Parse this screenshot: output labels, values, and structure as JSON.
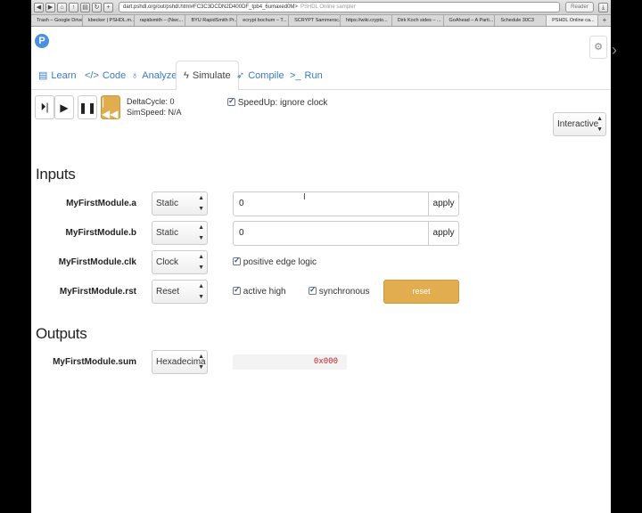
{
  "browser": {
    "url": "dart.pshdl.org/out/pshdl.html#FC3C3DCDN2D400DF_tpb4_6umaxed0M>",
    "page_title": "PSHDL Online sampler",
    "reader_label": "Reader",
    "bookmarks": [
      "Trash – Google Drive",
      "kbecker | PSHDL.m...",
      "rapidsmith – (Nwc...",
      "BYU RapidSmith Pr...",
      "ecrypt bochum – T...",
      "SCRYPT Sammersc...",
      "https://wiki.crypto...",
      "Dirk Koch sides – ...",
      "GoAhead – A Parti...",
      "Schedule 30C3",
      "PSHDL Online ca..."
    ]
  },
  "app": {
    "logo": "P",
    "corner_icon": "puzzle-icon",
    "tabs": [
      {
        "label": "Learn",
        "icon": "book-icon"
      },
      {
        "label": "Code",
        "icon": "code-icon"
      },
      {
        "label": "Analyze",
        "icon": "stethoscope-icon"
      },
      {
        "label": "Simulate",
        "icon": "bolt-icon"
      },
      {
        "label": "Compile",
        "icon": "rocket-icon"
      },
      {
        "label": "Run",
        "icon": "terminal-icon"
      }
    ],
    "active_tab": "Simulate"
  },
  "sim": {
    "delta_cycle": "DeltaCycle: 0",
    "sim_speed": "SimSpeed:  N/A",
    "speedup_label": "SpeedUp: ignore clock",
    "speedup_checked": true,
    "mode_select": "Interactive"
  },
  "inputs": {
    "heading": "Inputs",
    "rows": [
      {
        "name": "MyFirstModule.a",
        "mode": "Static",
        "value": "0",
        "apply_label": "apply"
      },
      {
        "name": "MyFirstModule.b",
        "mode": "Static",
        "value": "0",
        "apply_label": "apply"
      },
      {
        "name": "MyFirstModule.clk",
        "mode": "Clock",
        "option_label": "positive edge logic"
      },
      {
        "name": "MyFirstModule.rst",
        "mode": "Reset",
        "option_label": "active high",
        "option2_label": "synchronous",
        "button_label": "reset"
      }
    ]
  },
  "outputs": {
    "heading": "Outputs",
    "rows": [
      {
        "name": "MyFirstModule.sum",
        "mode": "Hexadecima",
        "value": "0x000"
      }
    ]
  },
  "colors": {
    "accent": "#e2ad4e",
    "link": "#3a7cc1",
    "value_red": "#c1272d"
  }
}
